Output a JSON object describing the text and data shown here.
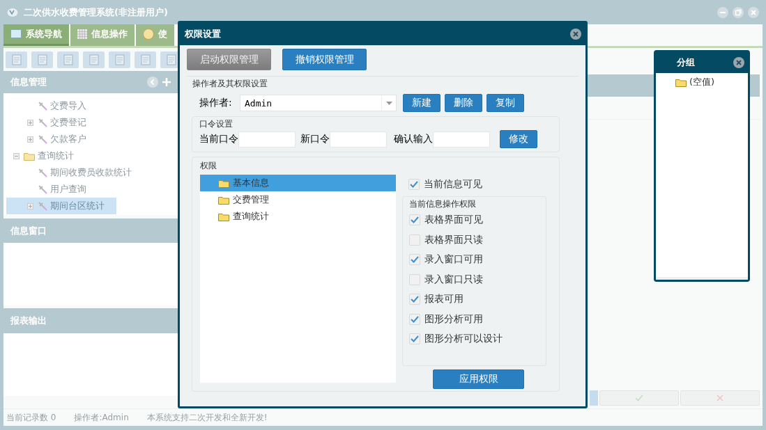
{
  "app": {
    "title": "二次供水收费管理系统(非注册用户)"
  },
  "tabs": [
    {
      "label": "系统导航",
      "selected": true
    },
    {
      "label": "信息操作",
      "selected": false
    },
    {
      "label": "使",
      "selected": false
    }
  ],
  "left_panel": {
    "sections": [
      {
        "title": "信息管理"
      },
      {
        "title": "信息窗口"
      },
      {
        "title": "报表输出"
      }
    ],
    "tree": {
      "continued_children": [
        {
          "label": "交费导入",
          "kind": "item",
          "selected": false
        },
        {
          "label": "交费登记",
          "kind": "item",
          "expanded": false,
          "selected": false
        },
        {
          "label": "欠款客户",
          "kind": "item",
          "expanded": false,
          "selected": false
        }
      ],
      "nodes": [
        {
          "label": "查询统计",
          "kind": "folder",
          "expanded": true,
          "selected": false,
          "children": [
            {
              "label": "期间收费员收款统计",
              "kind": "item",
              "selected": false
            },
            {
              "label": "用户查询",
              "kind": "item",
              "selected": false
            },
            {
              "label": "期间台区统计",
              "kind": "item",
              "expanded": false,
              "selected": true
            }
          ]
        }
      ]
    }
  },
  "status_bar": [
    "当前记录数 0",
    "操作者:Admin",
    "本系统支持二次开发和全新开发!"
  ],
  "dialog": {
    "title": "权限设置",
    "top_buttons": [
      {
        "label": "启动权限管理",
        "disabled": true
      },
      {
        "label": "撤销权限管理",
        "disabled": false
      }
    ],
    "operator": {
      "legend": "操作者及其权限设置",
      "label": "操作者:",
      "value": "Admin",
      "buttons": [
        "新建",
        "删除",
        "复制"
      ]
    },
    "password": {
      "legend": "口令设置",
      "fields": [
        {
          "label": "当前口令"
        },
        {
          "label": "新口令"
        },
        {
          "label": "确认输入"
        }
      ],
      "button": "修改"
    },
    "permissions": {
      "legend": "权限",
      "tree": [
        {
          "label": "基本信息",
          "selected": true
        },
        {
          "label": "交费管理",
          "selected": false
        },
        {
          "label": "查询统计",
          "selected": false
        }
      ],
      "visible": {
        "label": "当前信息可见",
        "checked": true
      },
      "ops_legend": "当前信息操作权限",
      "ops": [
        {
          "label": "表格界面可见",
          "checked": true
        },
        {
          "label": "表格界面只读",
          "checked": false
        },
        {
          "label": "录入窗口可用",
          "checked": true
        },
        {
          "label": "录入窗口只读",
          "checked": false
        },
        {
          "label": "报表可用",
          "checked": true
        },
        {
          "label": "图形分析可用",
          "checked": true
        },
        {
          "label": "图形分析可以设计",
          "checked": true
        }
      ],
      "apply_button": "应用权限"
    }
  },
  "group_popup": {
    "title": "分组",
    "items": [
      {
        "label": "(空值)"
      }
    ]
  }
}
